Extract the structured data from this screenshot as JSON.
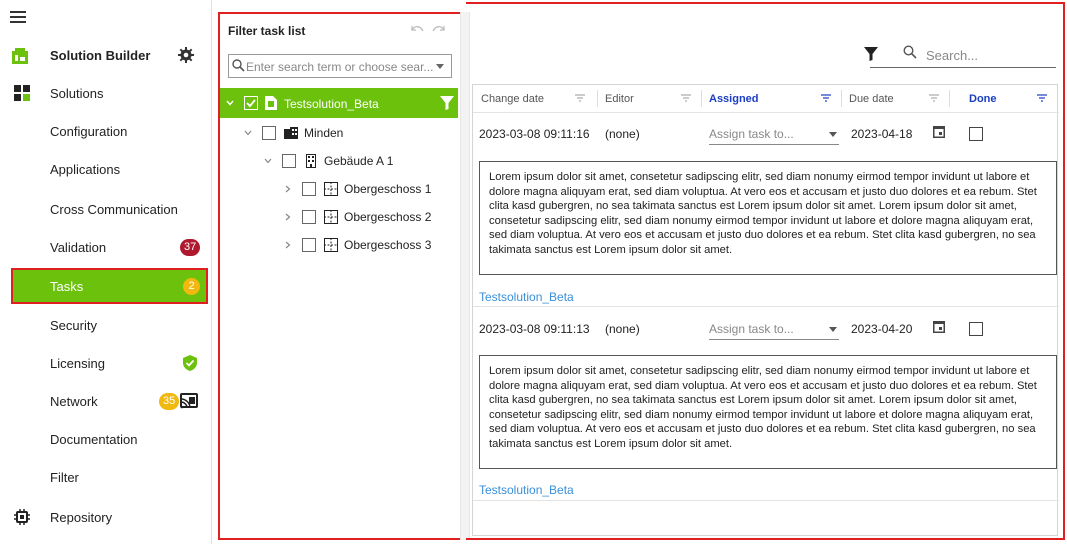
{
  "app": {
    "title": "Solution Builder"
  },
  "sidebar": {
    "items": [
      {
        "label": "Solutions"
      },
      {
        "label": "Configuration"
      },
      {
        "label": "Applications"
      },
      {
        "label": "Cross Communication"
      },
      {
        "label": "Validation",
        "badge": "37"
      },
      {
        "label": "Tasks",
        "badge": "2"
      },
      {
        "label": "Security"
      },
      {
        "label": "Licensing"
      },
      {
        "label": "Network",
        "badge": "35"
      },
      {
        "label": "Documentation"
      },
      {
        "label": "Filter"
      },
      {
        "label": "Repository"
      }
    ]
  },
  "filter_panel": {
    "title": "Filter task list",
    "search_placeholder": "Enter search term or choose sear...",
    "tree": {
      "root": "Testsolution_Beta",
      "level1": "Minden",
      "level2": "Gebäude A 1",
      "floors": [
        "Obergeschoss 1",
        "Obergeschoss 2",
        "Obergeschoss 3"
      ]
    }
  },
  "main": {
    "search_placeholder": "Search...",
    "columns": [
      {
        "label": "Change date"
      },
      {
        "label": "Editor"
      },
      {
        "label": "Assigned"
      },
      {
        "label": "Due date"
      },
      {
        "label": "Done"
      }
    ],
    "tasks": [
      {
        "change_date": "2023-03-08 09:11:16",
        "editor": "(none)",
        "assign_placeholder": "Assign task to...",
        "due_date": "2023-04-18",
        "description": "Lorem ipsum dolor sit amet, consetetur sadipscing elitr, sed diam nonumy eirmod tempor invidunt ut labore et dolore magna aliquyam erat, sed diam voluptua. At vero eos et accusam et justo duo dolores et ea rebum. Stet clita kasd gubergren, no sea takimata sanctus est Lorem ipsum dolor sit amet. Lorem ipsum dolor sit amet, consetetur sadipscing elitr, sed diam nonumy eirmod tempor invidunt ut labore et dolore magna aliquyam erat, sed diam voluptua. At vero eos et accusam et justo duo dolores et ea rebum. Stet clita kasd gubergren, no sea takimata sanctus est Lorem ipsum dolor sit amet.",
        "solution": "Testsolution_Beta"
      },
      {
        "change_date": "2023-03-08 09:11:13",
        "editor": "(none)",
        "assign_placeholder": "Assign task to...",
        "due_date": "2023-04-20",
        "description": "Lorem ipsum dolor sit amet, consetetur sadipscing elitr, sed diam nonumy eirmod tempor invidunt ut labore et dolore magna aliquyam erat, sed diam voluptua. At vero eos et accusam et justo duo dolores et ea rebum. Stet clita kasd gubergren, no sea takimata sanctus est Lorem ipsum dolor sit amet. Lorem ipsum dolor sit amet, consetetur sadipscing elitr, sed diam nonumy eirmod tempor invidunt ut labore et dolore magna aliquyam erat, sed diam voluptua. At vero eos et accusam et justo duo dolores et ea rebum. Stet clita kasd gubergren, no sea takimata sanctus est Lorem ipsum dolor sit amet.",
        "solution": "Testsolution_Beta"
      }
    ]
  },
  "colors": {
    "accent_green": "#6cc10d",
    "highlight_red": "#e02020",
    "badge_red": "#b0182e",
    "badge_yellow": "#f1b80f",
    "link_blue": "#3a8fd9",
    "header_blue": "#1a3ec2"
  },
  "icons": [
    "menu-icon",
    "solution-builder-logo",
    "gear-icon",
    "solutions-icon",
    "shield-check-icon",
    "cast-icon",
    "repository-icon",
    "undo-icon",
    "redo-icon",
    "search-icon",
    "filter-icon",
    "folder-icon",
    "building-icon",
    "floor-icon",
    "calendar-icon",
    "chevron-down-icon",
    "chevron-right-icon"
  ]
}
